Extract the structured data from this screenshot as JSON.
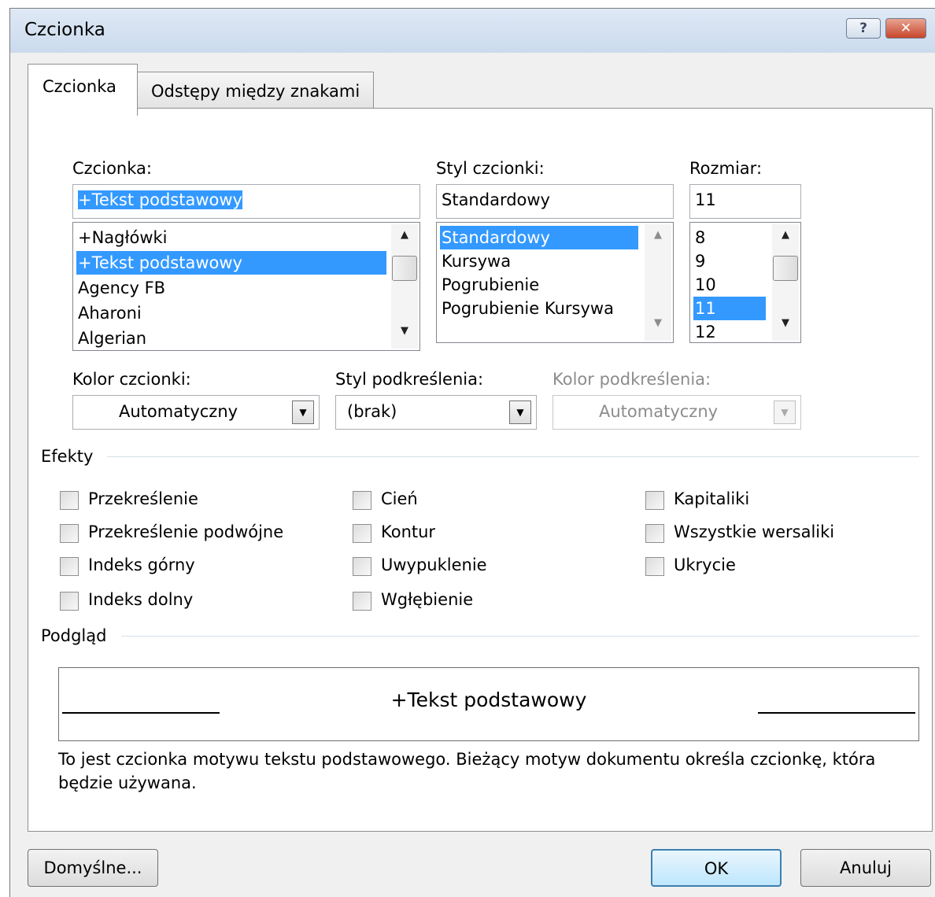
{
  "window": {
    "title": "Czcionka",
    "help_glyph": "?",
    "close_glyph": "✕"
  },
  "tabs": [
    {
      "label": "Czcionka",
      "active": true
    },
    {
      "label": "Odstępy między znakami",
      "active": false
    }
  ],
  "font": {
    "label": "Czcionka:",
    "value": "+Tekst podstawowy",
    "items": [
      "+Nagłówki",
      "+Tekst podstawowy",
      "Agency FB",
      "Aharoni",
      "Algerian"
    ],
    "selected_index": 1
  },
  "style": {
    "label": "Styl czcionki:",
    "value": "Standardowy",
    "items": [
      "Standardowy",
      "Kursywa",
      "Pogrubienie",
      "Pogrubienie Kursywa"
    ],
    "selected_index": 0
  },
  "size": {
    "label": "Rozmiar:",
    "value": "11",
    "items": [
      "8",
      "9",
      "10",
      "11",
      "12"
    ],
    "selected_index": 3
  },
  "font_color": {
    "label": "Kolor czcionki:",
    "value": "Automatyczny"
  },
  "underline_style": {
    "label": "Styl podkreślenia:",
    "value": "(brak)"
  },
  "underline_color": {
    "label": "Kolor podkreślenia:",
    "value": "Automatyczny",
    "disabled": true
  },
  "effects": {
    "label": "Efekty",
    "items": [
      {
        "label": "Przekreślenie",
        "checked": false
      },
      {
        "label": "Przekreślenie podwójne",
        "checked": false
      },
      {
        "label": "Indeks górny",
        "checked": false
      },
      {
        "label": "Indeks dolny",
        "checked": false
      },
      {
        "label": "Cień",
        "checked": false
      },
      {
        "label": "Kontur",
        "checked": false
      },
      {
        "label": "Uwypuklenie",
        "checked": false
      },
      {
        "label": "Wgłębienie",
        "checked": false
      },
      {
        "label": "Kapitaliki",
        "checked": false
      },
      {
        "label": "Wszystkie wersaliki",
        "checked": false
      },
      {
        "label": "Ukrycie",
        "checked": false
      }
    ]
  },
  "preview": {
    "label": "Podgląd",
    "sample": "+Tekst podstawowy",
    "description": "To jest czcionka motywu tekstu podstawowego. Bieżący motyw dokumentu określa czcionkę, która będzie używana."
  },
  "buttons": {
    "default": "Domyślne...",
    "ok": "OK",
    "cancel": "Anuluj"
  },
  "colors": {
    "selection": "#3399ff",
    "default_button_border": "#3c7fb1"
  }
}
